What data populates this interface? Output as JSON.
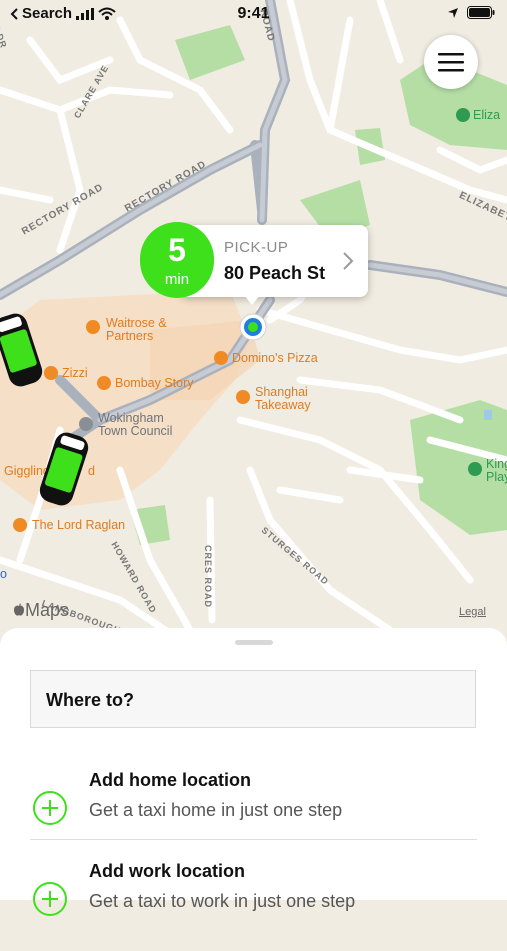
{
  "status_bar": {
    "back_app": "Search",
    "time": "9:41"
  },
  "map": {
    "labels": {
      "elizabeth_poi": "Eliza",
      "king_poi_1": "King",
      "king_poi_2": "Play",
      "waitrose_1": "Waitrose &",
      "waitrose_2": "Partners",
      "dominos": "Domino's Pizza",
      "zizzi": "Zizzi",
      "bombay": "Bombay Story",
      "shanghai_1": "Shanghai",
      "shanghai_2": "Takeaway",
      "council_1": "Wokingham",
      "council_2": "Town Council",
      "giggling": "Giggling",
      "giggling_tail": "d",
      "lord_raglan": "The Lord Raglan",
      "partial_o": "o"
    },
    "roads": {
      "rectory_1": "RECTORY ROAD",
      "rectory_2": "RECTORY ROAD",
      "clare": "CLARE AVE",
      "road_top": "ROAD",
      "elizabeth_rd": "ELIZABETH",
      "howard": "HOWARD ROAD",
      "cres": "CRES ROAD",
      "sturges": "STURGES ROAD",
      "langborough": "LANGBOROUGH ROAD",
      "corner_dr": "N DR"
    },
    "maps_logo": "Maps",
    "legal": "Legal"
  },
  "pickup": {
    "eta_value": "5",
    "eta_unit": "min",
    "label": "PICK-UP",
    "address": "80 Peach St"
  },
  "sheet": {
    "search_placeholder": "Where to?",
    "home": {
      "title": "Add home location",
      "subtitle": "Get a taxi home in just one step"
    },
    "work": {
      "title": "Add work location",
      "subtitle": "Get a taxi to work in just one step"
    }
  },
  "colors": {
    "accent": "#3ee01c",
    "map_bg": "#f1ece1",
    "park": "#b5dea5",
    "road_main": "#a9b1bd",
    "poi_orange": "#f08a24"
  }
}
